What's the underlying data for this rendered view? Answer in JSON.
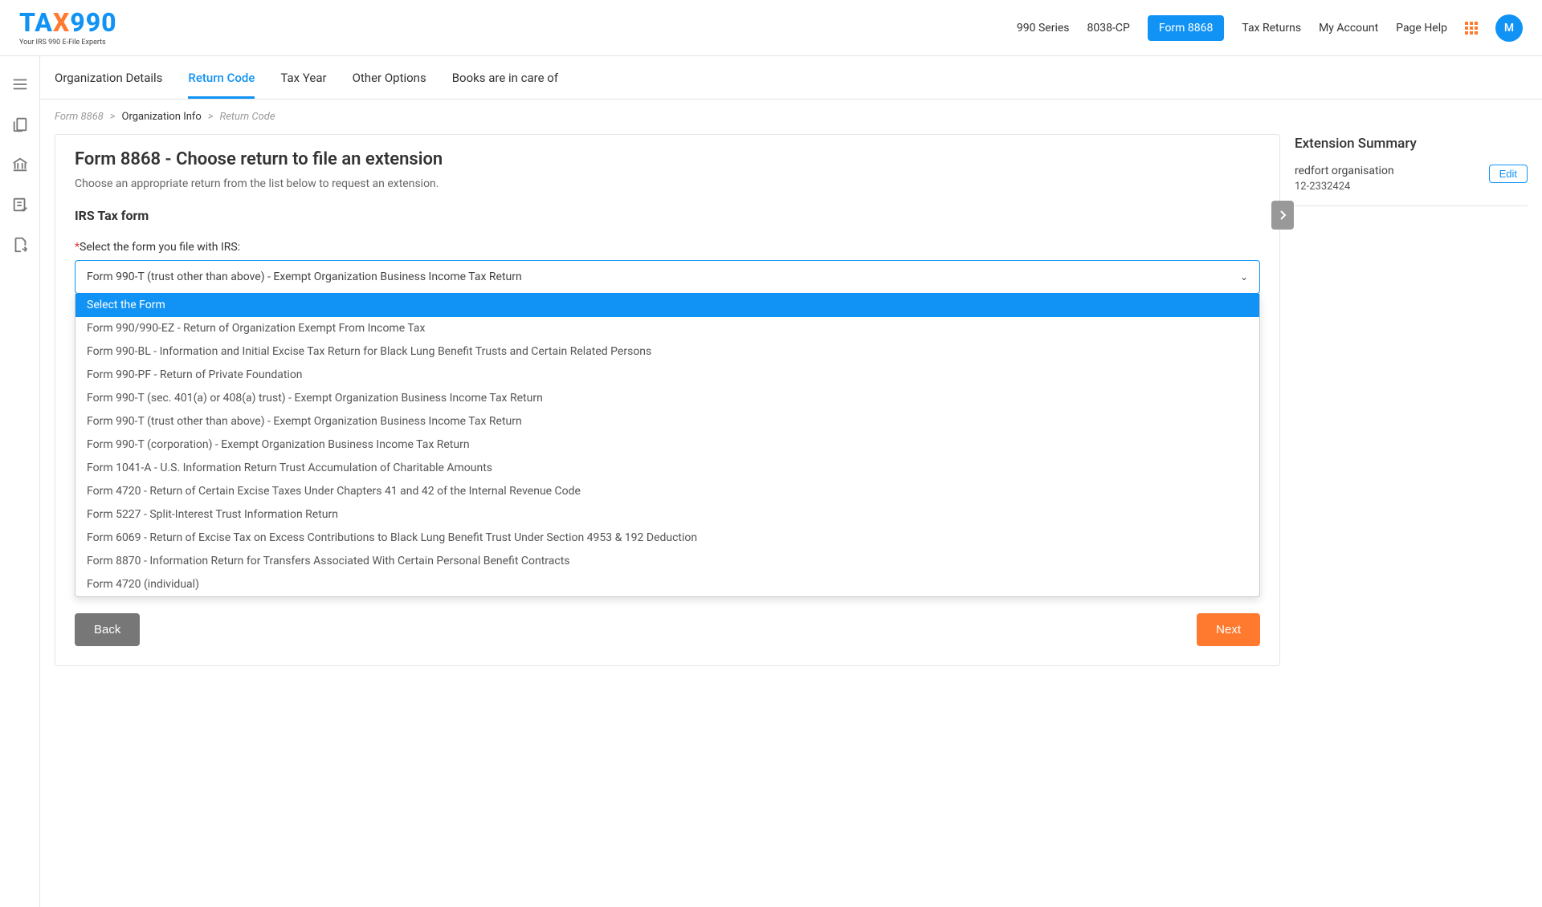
{
  "logo": {
    "part1": "TA",
    "part_x": "X",
    "part2": "990",
    "sub": "Your IRS 990 E-File Experts"
  },
  "topnav": {
    "series": "990 Series",
    "cp": "8038-CP",
    "form8868": "Form 8868",
    "taxreturns": "Tax Returns",
    "myaccount": "My Account",
    "pagehelp": "Page Help"
  },
  "avatar_letter": "M",
  "subtabs": {
    "org": "Organization Details",
    "return_code": "Return Code",
    "tax_year": "Tax Year",
    "other": "Other Options",
    "books": "Books are in care of"
  },
  "breadcrumb": {
    "root": "Form 8868",
    "mid": "Organization Info",
    "leaf": "Return Code",
    "sep": ">"
  },
  "card": {
    "title": "Form 8868 - Choose return to file an extension",
    "desc": "Choose an appropriate return from the list below to request an extension.",
    "section": "IRS Tax form",
    "field_label": "Select the form you file with IRS:",
    "selected": "Form 990-T (trust other than above) - Exempt Organization Business Income Tax Return",
    "options": [
      "Select the Form",
      "Form 990/990-EZ - Return of Organization Exempt From Income Tax",
      "Form 990-BL - Information and Initial Excise Tax Return for Black Lung Benefit Trusts and Certain Related Persons",
      "Form 990-PF - Return of Private Foundation",
      "Form 990-T (sec. 401(a) or 408(a) trust) - Exempt Organization Business Income Tax Return",
      "Form 990-T (trust other than above) - Exempt Organization Business Income Tax Return",
      "Form 990-T (corporation) - Exempt Organization Business Income Tax Return",
      "Form 1041-A - U.S. Information Return Trust Accumulation of Charitable Amounts",
      "Form 4720 - Return of Certain Excise Taxes Under Chapters 41 and 42 of the Internal Revenue Code",
      "Form 5227 - Split-Interest Trust Information Return",
      "Form 6069 - Return of Excise Tax on Excess Contributions to Black Lung Benefit Trust Under Section 4953 & 192 Deduction",
      "Form 8870 - Information Return for Transfers Associated With Certain Personal Benefit Contracts",
      "Form 4720 (individual)"
    ],
    "back": "Back",
    "next": "Next"
  },
  "summary": {
    "title": "Extension Summary",
    "org": "redfort organisation",
    "ein": "12-2332424",
    "edit": "Edit"
  }
}
